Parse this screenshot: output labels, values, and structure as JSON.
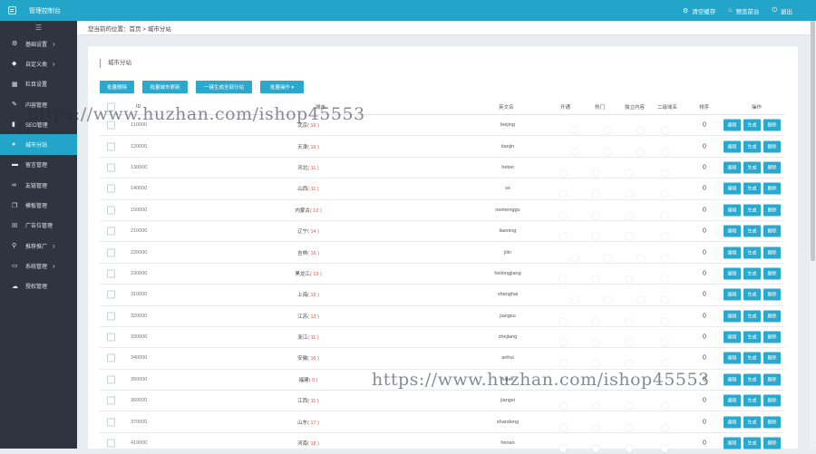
{
  "topbar": {
    "title": "管理控制台",
    "actions": [
      {
        "icon": "gear-icon",
        "glyph": "⚙",
        "label": "清空缓存"
      },
      {
        "icon": "home-icon",
        "glyph": "⌂",
        "label": "预览前台"
      },
      {
        "icon": "power-icon",
        "glyph": "⏻",
        "label": "退出"
      }
    ]
  },
  "sidebar": {
    "toggle": "☰",
    "items": [
      {
        "icon": "gear-icon",
        "glyph": "⚙",
        "label": "基础设置",
        "arrow": "›"
      },
      {
        "icon": "tag-icon",
        "glyph": "◆",
        "label": "自定义类",
        "arrow": "›"
      },
      {
        "icon": "grid-icon",
        "glyph": "▦",
        "label": "栏目设置",
        "arrow": ""
      },
      {
        "icon": "edit-icon",
        "glyph": "✎",
        "label": "内容管理",
        "arrow": ""
      },
      {
        "icon": "chart-icon",
        "glyph": "▮",
        "label": "SEO管理",
        "arrow": ""
      },
      {
        "icon": "globe-icon",
        "glyph": "●",
        "label": "城市分站",
        "arrow": ""
      },
      {
        "icon": "comment-icon",
        "glyph": "▬",
        "label": "留言管理",
        "arrow": ""
      },
      {
        "icon": "link-icon",
        "glyph": "∞",
        "label": "友链管理",
        "arrow": ""
      },
      {
        "icon": "copy-icon",
        "glyph": "❐",
        "label": "模板管理",
        "arrow": ""
      },
      {
        "icon": "close-box-icon",
        "glyph": "☒",
        "label": "广告位管理",
        "arrow": ""
      },
      {
        "icon": "network-icon",
        "glyph": "⚲",
        "label": "推荐推广",
        "arrow": "›"
      },
      {
        "icon": "monitor-icon",
        "glyph": "▭",
        "label": "系统管理",
        "arrow": "›"
      },
      {
        "icon": "cloud-icon",
        "glyph": "☁",
        "label": "授权管理",
        "arrow": ""
      }
    ]
  },
  "breadcrumb": "您当前的位置：首页 > 城市分站",
  "panel": {
    "title": "城市分站",
    "buttons": [
      "批量删除",
      "批量城市更新",
      "一键生成全部分站",
      "批量操作 ▾"
    ]
  },
  "table": {
    "headers": {
      "code": "ID",
      "name": "城市",
      "pinyin": "英文名",
      "open": "开通",
      "hot": "热门",
      "independent": "独立内容",
      "secondary": "二级域名",
      "sort": "排序",
      "ops": "操作"
    },
    "op_labels": [
      "编辑",
      "生成",
      "删除"
    ],
    "rows": [
      {
        "code": "110000",
        "name": "北京",
        "count": "( 16 )",
        "pinyin": "beijing",
        "sw": [
          true,
          true,
          true,
          false
        ],
        "sort": "0"
      },
      {
        "code": "120000",
        "name": "天津",
        "count": "( 16 )",
        "pinyin": "tianjin",
        "sw": [
          true,
          true,
          true,
          false
        ],
        "sort": "0"
      },
      {
        "code": "130000",
        "name": "河北",
        "count": "( 11 )",
        "pinyin": "hebei",
        "sw": [
          false,
          false,
          false,
          false
        ],
        "sort": "0"
      },
      {
        "code": "140000",
        "name": "山西",
        "count": "( 11 )",
        "pinyin": "sx",
        "sw": [
          false,
          false,
          false,
          false
        ],
        "sort": "0"
      },
      {
        "code": "150000",
        "name": "内蒙古",
        "count": "( 12 )",
        "pinyin": "neimenggu",
        "sw": [
          false,
          false,
          false,
          false
        ],
        "sort": "0"
      },
      {
        "code": "210000",
        "name": "辽宁",
        "count": "( 14 )",
        "pinyin": "liaoning",
        "sw": [
          false,
          false,
          false,
          false
        ],
        "sort": "0"
      },
      {
        "code": "220000",
        "name": "吉林",
        "count": "( 16 )",
        "pinyin": "jilin",
        "sw": [
          true,
          true,
          true,
          false
        ],
        "sort": "0"
      },
      {
        "code": "230000",
        "name": "黑龙江",
        "count": "( 13 )",
        "pinyin": "heilongjiang",
        "sw": [
          false,
          false,
          false,
          false
        ],
        "sort": "0"
      },
      {
        "code": "310000",
        "name": "上海",
        "count": "( 16 )",
        "pinyin": "shanghai",
        "sw": [
          true,
          true,
          true,
          false
        ],
        "sort": "0"
      },
      {
        "code": "320000",
        "name": "江苏",
        "count": "( 13 )",
        "pinyin": "jiangsu",
        "sw": [
          false,
          false,
          false,
          false
        ],
        "sort": "0"
      },
      {
        "code": "330000",
        "name": "浙江",
        "count": "( 11 )",
        "pinyin": "zhejiang",
        "sw": [
          false,
          false,
          false,
          false
        ],
        "sort": "0"
      },
      {
        "code": "340000",
        "name": "安徽",
        "count": "( 16 )",
        "pinyin": "anhui",
        "sw": [
          false,
          false,
          false,
          false
        ],
        "sort": "0"
      },
      {
        "code": "350000",
        "name": "福建",
        "count": "( 9 )",
        "pinyin": "fujian",
        "sw": [
          false,
          false,
          false,
          false
        ],
        "sort": "0"
      },
      {
        "code": "360000",
        "name": "江西",
        "count": "( 11 )",
        "pinyin": "jiangxi",
        "sw": [
          false,
          false,
          false,
          false
        ],
        "sort": "0"
      },
      {
        "code": "370000",
        "name": "山东",
        "count": "( 17 )",
        "pinyin": "shandong",
        "sw": [
          false,
          false,
          false,
          false
        ],
        "sort": "0"
      },
      {
        "code": "410000",
        "name": "河南",
        "count": "( 18 )",
        "pinyin": "henan",
        "sw": [
          false,
          false,
          false,
          false
        ],
        "sort": "0"
      }
    ]
  },
  "watermark": "https://www.huzhan.com/ishop45553"
}
